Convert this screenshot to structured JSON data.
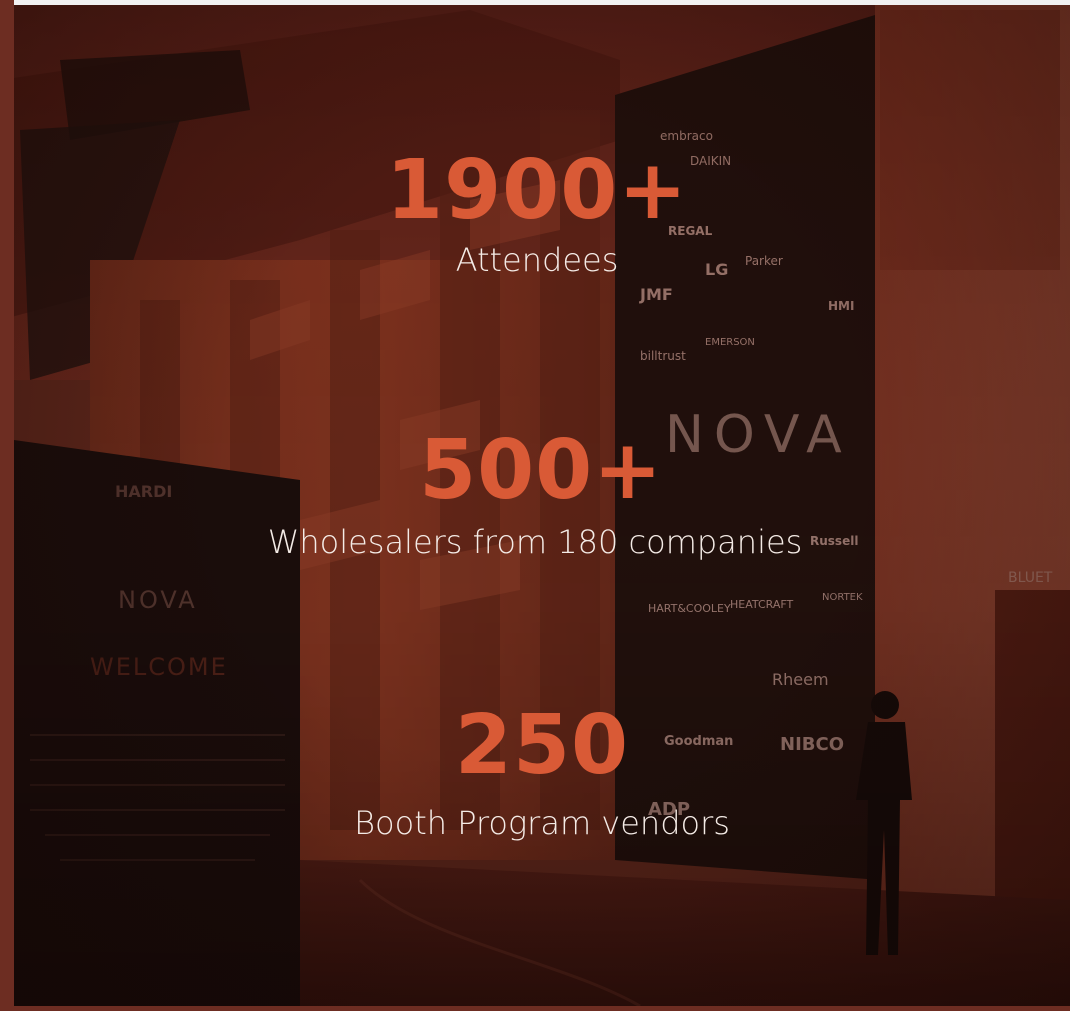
{
  "stats": [
    {
      "number": "1900+",
      "label": "Attendees"
    },
    {
      "number": "500+",
      "label": "Wholesalers from 180 companies"
    },
    {
      "number": "250",
      "label": "Booth Program vendors"
    }
  ],
  "scene": {
    "sign_brand": "HARDI",
    "sign_logo": "NOVA",
    "sign_welcome": "WELCOME",
    "backdrop_logo": "NOVA",
    "door_sign": "BLUET",
    "sponsor_logos": [
      "embraco",
      "DAIKIN",
      "REGAL",
      "LG",
      "JMF",
      "billtrust",
      "EMERSON",
      "Parker",
      "HMI",
      "Russell",
      "NORTEK",
      "HEATCRAFT",
      "HART & COOLEY",
      "Rheem",
      "Goodman",
      "NIBCO",
      "ADP"
    ]
  },
  "colors": {
    "accent": "#d95a36",
    "label_text": "#f4ebe6",
    "tint": "#7a3a2a"
  }
}
